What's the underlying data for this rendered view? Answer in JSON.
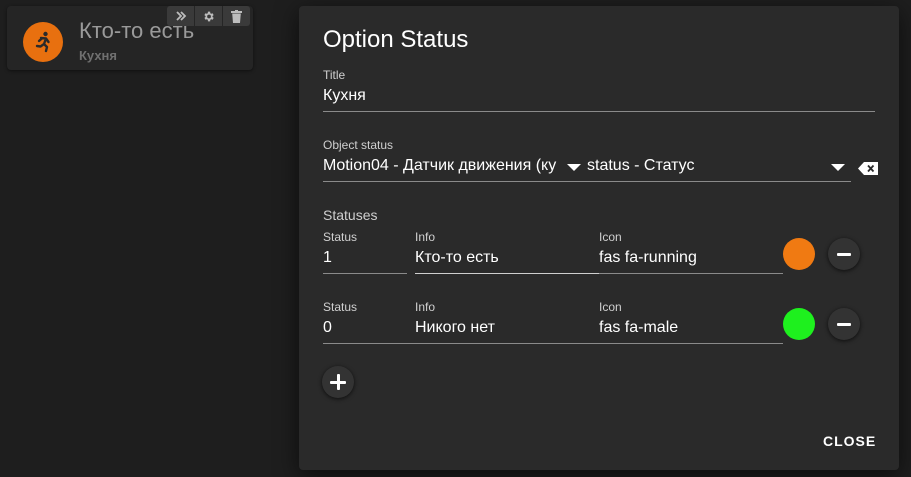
{
  "widget": {
    "title": "Кто-то есть",
    "subtitle": "Кухня",
    "icon": "running-icon",
    "icon_color": "#e8700f",
    "toolbar": {
      "expand_icon": "double-chevron-right-icon",
      "settings_icon": "gear-icon",
      "delete_icon": "trash-icon"
    }
  },
  "dialog": {
    "title": "Option Status",
    "title_field": {
      "label": "Title",
      "value": "Кухня"
    },
    "object_status": {
      "label": "Object status",
      "object_value": "Motion04 - Датчик движения (ку",
      "property_value": "status - Статус"
    },
    "statuses": {
      "heading": "Statuses",
      "column_labels": {
        "status": "Status",
        "info": "Info",
        "icon": "Icon"
      },
      "rows": [
        {
          "status": "1",
          "info": "Кто-то есть",
          "icon": "fas fa-running",
          "color": "#f07a12"
        },
        {
          "status": "0",
          "info": "Никого нет",
          "icon": "fas fa-male",
          "color": "#1ef01e"
        }
      ]
    },
    "close_label": "CLOSE"
  }
}
